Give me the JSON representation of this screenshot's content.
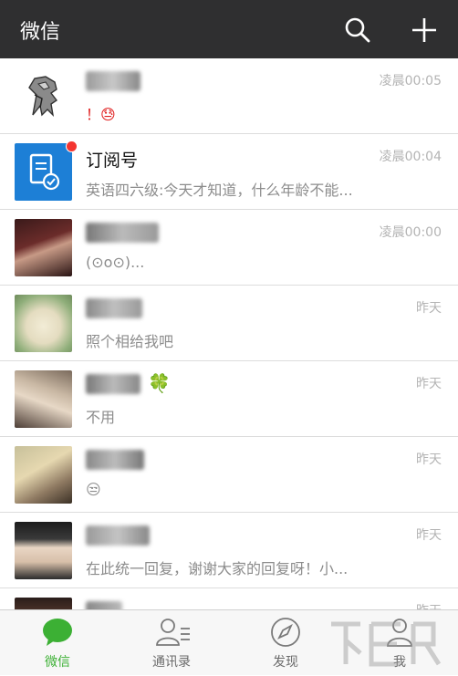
{
  "header": {
    "title": "微信",
    "search_icon": "search-icon",
    "add_icon": "plus-icon"
  },
  "chats": [
    {
      "name": "",
      "name_blurred": true,
      "preview": "！😓",
      "time": "凌晨00:05",
      "avatar": "peugeot-lion-logo"
    },
    {
      "name": "订阅号",
      "name_blurred": false,
      "preview": "英语四六级:今天才知道，什么年龄不能...",
      "time": "凌晨00:04",
      "avatar": "subscription-icon",
      "unread_dot": true
    },
    {
      "name": "",
      "name_blurred": true,
      "preview": "(⊙o⊙)...",
      "time": "凌晨00:00",
      "avatar": "photo-avatar"
    },
    {
      "name": "",
      "name_blurred": true,
      "preview": "照个相给我吧",
      "time": "昨天",
      "avatar": "plush-rabbit-photo"
    },
    {
      "name": "",
      "name_blurred": true,
      "name_suffix": "🍀",
      "preview": "不用",
      "time": "昨天",
      "avatar": "photo-avatar"
    },
    {
      "name": "",
      "name_blurred": true,
      "preview": "😒",
      "time": "昨天",
      "avatar": "photo-avatar"
    },
    {
      "name": "",
      "name_blurred": true,
      "preview": "在此统一回复，谢谢大家的回复呀！小...",
      "time": "昨天",
      "avatar": "photo-avatar"
    },
    {
      "name": "",
      "name_blurred": true,
      "preview": "",
      "time": "昨天",
      "avatar": "photo-avatar"
    }
  ],
  "tabs": [
    {
      "label": "微信",
      "icon": "chat-bubble-icon",
      "active": true
    },
    {
      "label": "通讯录",
      "icon": "contacts-icon",
      "active": false
    },
    {
      "label": "发现",
      "icon": "compass-icon",
      "active": false
    },
    {
      "label": "我",
      "icon": "person-icon",
      "active": false
    }
  ],
  "colors": {
    "header_bg": "#2f2f30",
    "accent": "#3cb034",
    "unread": "#f43530",
    "subscription_blue": "#1d7fd6"
  }
}
